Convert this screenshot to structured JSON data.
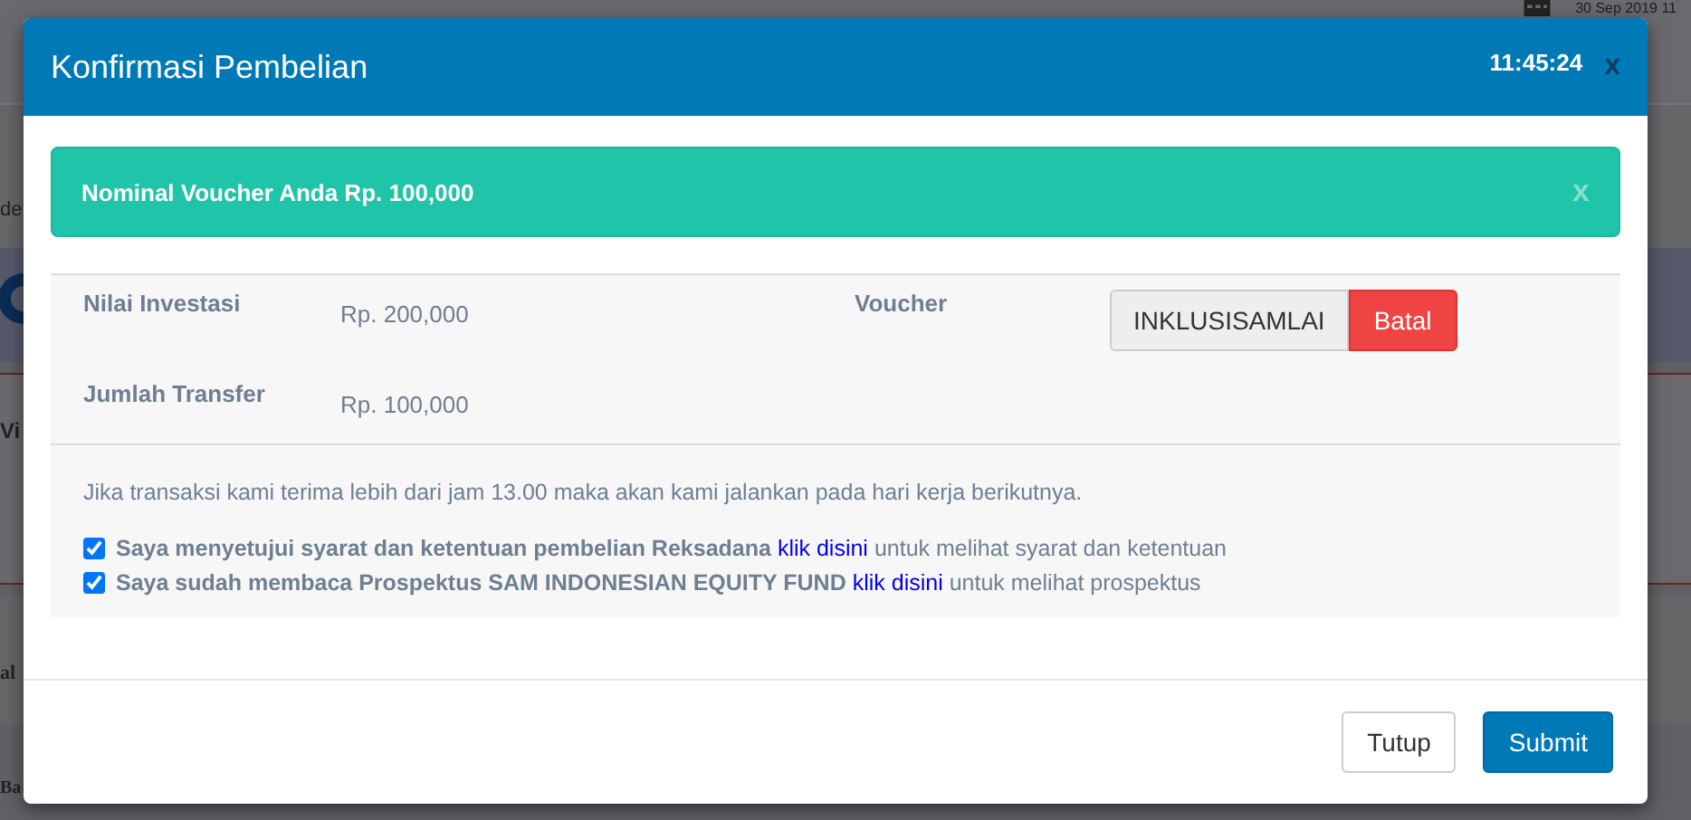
{
  "background": {
    "date": "30 Sep 2019 11",
    "note": "de",
    "card_title": "Vi",
    "section_1": "al",
    "section_2": "Ba"
  },
  "modal": {
    "title": "Konfirmasi Pembelian",
    "time": "11:45:24",
    "close": "x",
    "alert": {
      "text": "Nominal Voucher Anda Rp. 100,000",
      "close": "x"
    },
    "details": [
      {
        "label": "Nilai Investasi",
        "value": "Rp. 200,000"
      },
      {
        "label": "Jumlah Transfer",
        "value": "Rp. 100,000"
      }
    ],
    "voucher": {
      "label": "Voucher",
      "code": "INKLUSISAMLAI",
      "cancel": "Batal"
    },
    "notice": "Jika transaksi kami terima lebih dari jam 13.00 maka akan kami jalankan pada hari kerja berikutnya.",
    "agreements": [
      {
        "checked": true,
        "text": "Saya menyetujui syarat dan ketentuan pembelian Reksadana",
        "link": "klik disini",
        "rest": "untuk melihat syarat dan ketentuan"
      },
      {
        "checked": true,
        "text": "Saya sudah membaca Prospektus SAM INDONESIAN EQUITY FUND",
        "link": "klik disini",
        "rest": "untuk melihat prospektus"
      }
    ],
    "buttons": [
      {
        "label": "Tutup",
        "kind": "default"
      },
      {
        "label": "Submit",
        "kind": "primary"
      }
    ]
  }
}
